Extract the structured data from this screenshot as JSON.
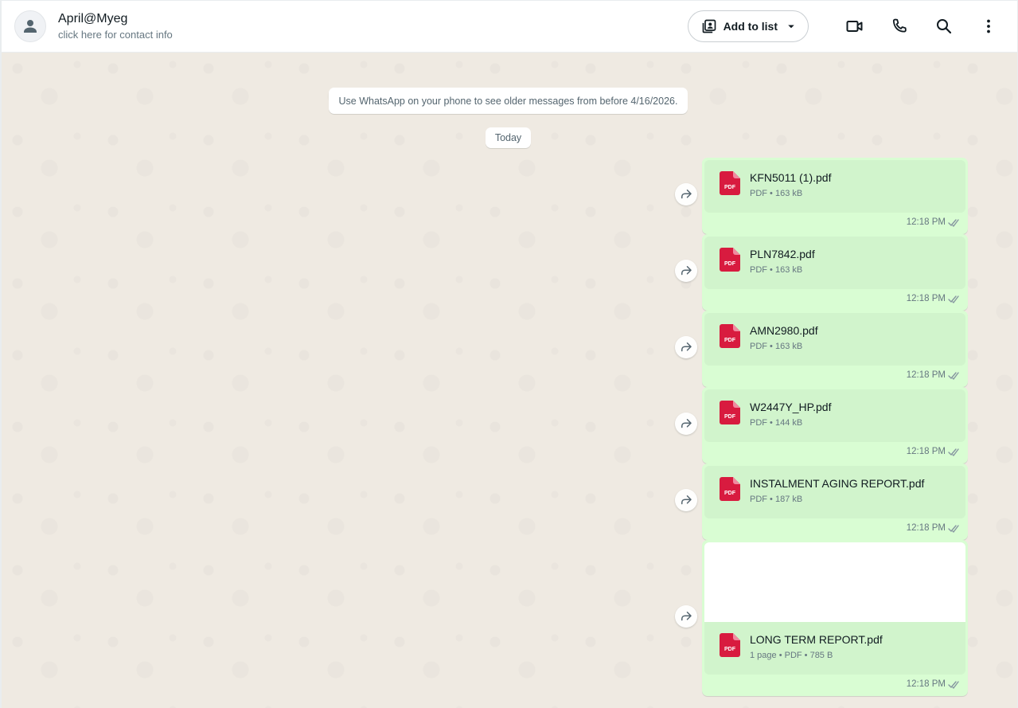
{
  "header": {
    "contact_name": "April@Myeg",
    "contact_subtitle": "click here for contact info",
    "add_to_list_label": "Add to list"
  },
  "chat": {
    "notice": "Use WhatsApp on your phone to see older messages from before 4/16/2026.",
    "date_chip": "Today",
    "messages": [
      {
        "name": "KFN5011 (1).pdf",
        "meta": "PDF • 163 kB",
        "time": "12:18 PM"
      },
      {
        "name": "PLN7842.pdf",
        "meta": "PDF • 163 kB",
        "time": "12:18 PM"
      },
      {
        "name": "AMN2980.pdf",
        "meta": "PDF • 163 kB",
        "time": "12:18 PM"
      },
      {
        "name": "W2447Y_HP.pdf",
        "meta": "PDF • 144 kB",
        "time": "12:18 PM"
      },
      {
        "name": "INSTALMENT AGING REPORT.pdf",
        "meta": "PDF • 187 kB",
        "time": "12:18 PM"
      },
      {
        "name": "LONG TERM REPORT.pdf",
        "meta": "1 page • PDF • 785 B",
        "time": "12:18 PM"
      }
    ]
  },
  "icons": {
    "pdf_badge": "PDF"
  },
  "colors": {
    "bubble_outgoing": "#d9fdd3",
    "doc_card": "#d1f4cc",
    "chat_bg": "#efeae2",
    "pdf_red": "#d81b3f",
    "read_ticks": "#8696a0"
  }
}
